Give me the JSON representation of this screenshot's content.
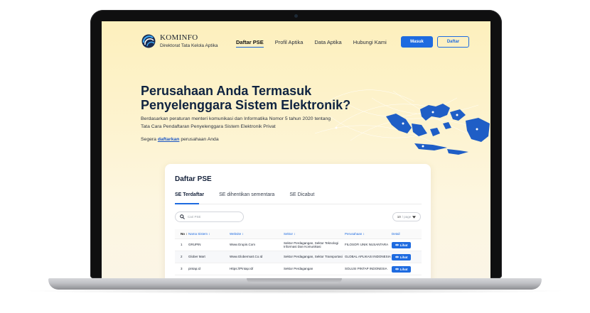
{
  "brand": {
    "name": "KOMINFO",
    "subtitle": "Direktorat Tata Kelola Aptika"
  },
  "nav": {
    "links": [
      "Daftar PSE",
      "Profil Aptika",
      "Data Aptika",
      "Hubungi Kami"
    ],
    "active": "Daftar PSE",
    "masuk_label": "Masuk",
    "daftar_label": "Daftar"
  },
  "hero": {
    "title": "Perusahaan Anda Termasuk Penyelenggara Sistem Elektronik?",
    "text": "Berdasarkan peraturan menteri komunikasi dan Informatika Nomor 5 tahun 2020 tentang Tata Cara Pendaftaran Penyelenggara Sistem Elektronik Privat",
    "cta_prefix": "Segera",
    "cta_link": "daftarkan",
    "cta_suffix": "perusahaan Anda"
  },
  "card": {
    "title": "Daftar PSE",
    "tabs": [
      "SE Terdaftar",
      "SE dihentikan sementara",
      "SE Dicabut"
    ],
    "search_placeholder": "Cari PSE",
    "perpage_value": "10",
    "perpage_suffix": "/ page"
  },
  "table": {
    "headers": {
      "no": "No ↕",
      "nama": "Nama Sistem ↕",
      "website": "Website ↕",
      "sektor": "Sektor ↕",
      "perusahaan": "Perusahaan ↕",
      "detail": "Detail"
    },
    "lihat_label": "Lihat",
    "rows": [
      {
        "no": "1",
        "nama": "GRUPIN",
        "website": "Www.Grupin.Com",
        "sektor": "Sektor Perdagangan, Sektor Teknologi Informasi Dan Komunikasi",
        "perusahaan": "FILOSOFI UNIK NUSANTARA"
      },
      {
        "no": "2",
        "nama": "Glober Mart",
        "website": "Www.Globermart.Co.Id",
        "sektor": "Sektor Perdagangan, Sektor Transportasi",
        "perusahaan": "GLOBAL APLIKASI INDONESIA"
      },
      {
        "no": "3",
        "nama": "pintap.id",
        "website": "Https://Pintap.Id/",
        "sektor": "Sektor Perdagangan",
        "perusahaan": "SOLUSI PINTAP INDONESIA"
      }
    ]
  },
  "colors": {
    "primary": "#1e6be0",
    "heading": "#0f2340",
    "map": "#1e5fc4"
  }
}
